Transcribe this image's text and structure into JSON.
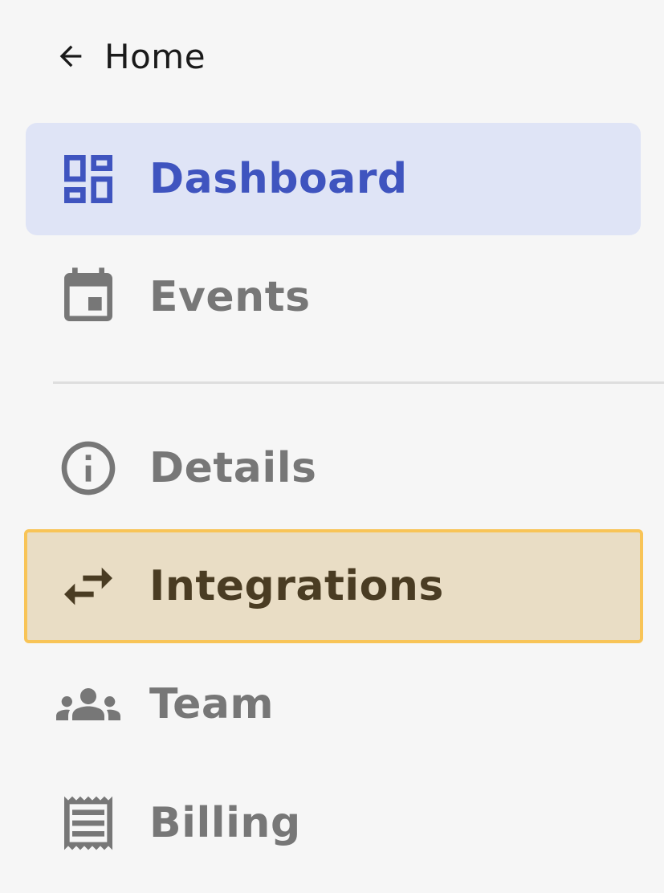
{
  "back": {
    "label": "Home",
    "icon": "arrow-left-icon"
  },
  "nav": {
    "primary": [
      {
        "label": "Dashboard",
        "icon": "dashboard-icon",
        "active": true
      },
      {
        "label": "Events",
        "icon": "calendar-icon",
        "active": false
      }
    ],
    "secondary": [
      {
        "label": "Details",
        "icon": "info-icon",
        "active": false
      },
      {
        "label": "Integrations",
        "icon": "swap-arrows-icon",
        "active": false,
        "highlighted": true
      },
      {
        "label": "Team",
        "icon": "people-icon",
        "active": false
      },
      {
        "label": "Billing",
        "icon": "receipt-icon",
        "active": false
      }
    ]
  },
  "colors": {
    "background": "#f6f6f6",
    "active_bg": "#dfe4f6",
    "active_text": "#3f54bf",
    "inactive_text": "#777777",
    "highlight_bg": "#e9ddc5",
    "highlight_border": "#f8c457",
    "highlight_text": "#4a3c23"
  }
}
